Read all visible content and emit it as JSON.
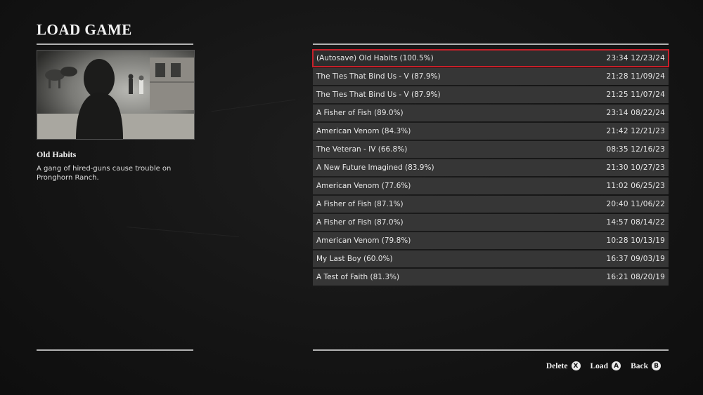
{
  "screen": {
    "title": "LOAD GAME"
  },
  "selected_mission": {
    "name": "Old Habits",
    "description": "A gang of hired-guns cause trouble on Pronghorn Ranch."
  },
  "saves": [
    {
      "name": "(Autosave) Old Habits (100.5%)",
      "time": "23:34  12/23/24",
      "selected": true
    },
    {
      "name": "The Ties That Bind Us - V (87.9%)",
      "time": "21:28  11/09/24"
    },
    {
      "name": "The Ties That Bind Us - V (87.9%)",
      "time": "21:25  11/07/24"
    },
    {
      "name": "A Fisher of Fish (89.0%)",
      "time": "23:14  08/22/24"
    },
    {
      "name": "American Venom (84.3%)",
      "time": "21:42  12/21/23"
    },
    {
      "name": "The Veteran - IV (66.8%)",
      "time": "08:35  12/16/23"
    },
    {
      "name": "A New Future Imagined (83.9%)",
      "time": "21:30  10/27/23"
    },
    {
      "name": "American Venom (77.6%)",
      "time": "11:02  06/25/23"
    },
    {
      "name": "A Fisher of Fish (87.1%)",
      "time": "20:40  11/06/22"
    },
    {
      "name": "A Fisher of Fish (87.0%)",
      "time": "14:57  08/14/22"
    },
    {
      "name": "American Venom (79.8%)",
      "time": "10:28  10/13/19"
    },
    {
      "name": "My Last Boy (60.0%)",
      "time": "16:37  09/03/19"
    },
    {
      "name": "A Test of Faith (81.3%)",
      "time": "16:21  08/20/19"
    }
  ],
  "prompts": {
    "delete": {
      "label": "Delete",
      "button": "X"
    },
    "load": {
      "label": "Load",
      "button": "A"
    },
    "back": {
      "label": "Back",
      "button": "B"
    }
  },
  "colors": {
    "selection_outline": "#c8202a",
    "row_bg": "#363636",
    "background": "#151515"
  },
  "icons": {
    "preview": "mission-preview-image",
    "delete": "x-button-icon",
    "load": "a-button-icon",
    "back": "b-button-icon"
  }
}
